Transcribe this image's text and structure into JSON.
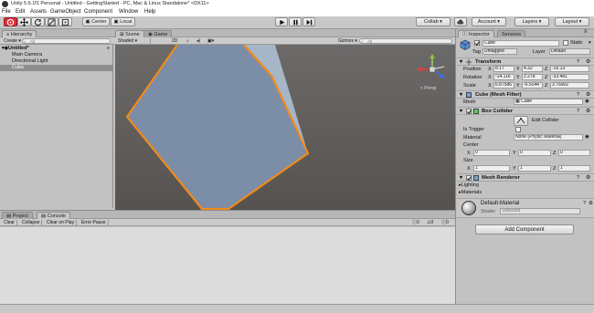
{
  "window": {
    "title": "Unity 5.6.1f1 Personal - Untitled - GettingStarted - PC, Mac & Linux Standalone* <DX11>"
  },
  "menu": [
    "File",
    "Edit",
    "Assets",
    "GameObject",
    "Component",
    "Window",
    "Help"
  ],
  "toolbar": {
    "pivot": "Center",
    "space": "Local",
    "collab": "Collab",
    "account": "Account",
    "layers": "Layers",
    "layout": "Layout"
  },
  "hierarchy": {
    "tab": "Hierarchy",
    "create": "Create",
    "search_placeholder": "All",
    "scene_name": "Untitled*",
    "items": [
      "Main Camera",
      "Directional Light",
      "Cube"
    ]
  },
  "scene": {
    "tab_scene": "Scene",
    "tab_game": "Game",
    "shading": "Shaded",
    "mode_2d": "2D",
    "gizmos": "Gizmos",
    "search_placeholder": "All",
    "persp": "< Persp"
  },
  "bottom": {
    "tab_project": "Project",
    "tab_console": "Console",
    "buttons": [
      "Clear",
      "Collapse",
      "Clear on Play",
      "Error Pause"
    ],
    "counts": [
      "0",
      "0",
      "0"
    ]
  },
  "inspector": {
    "tab": "Inspector",
    "tab_services": "Services",
    "object_name": "Cube",
    "static_label": "Static",
    "tag_label": "Tag",
    "tag_value": "Untagged",
    "layer_label": "Layer",
    "layer_value": "Default",
    "transform": {
      "title": "Transform",
      "position_label": "Position",
      "rotation_label": "Rotation",
      "scale_label": "Scale",
      "position": [
        "8.17",
        "4.32",
        "-16.13"
      ],
      "rotation": [
        "-14.116",
        "2.278",
        "-33.481"
      ],
      "scale": [
        "6.87586",
        "-6.9144",
        "3.76902"
      ],
      "x": "X",
      "y": "Y",
      "z": "Z"
    },
    "mesh_filter": {
      "title": "Cube (Mesh Filter)",
      "mesh_label": "Mesh",
      "mesh_value": "Cube"
    },
    "box_collider": {
      "title": "Box Collider",
      "edit_label": "Edit Collider",
      "is_trigger_label": "Is Trigger",
      "material_label": "Material",
      "material_value": "None (Physic Material)",
      "center_label": "Center",
      "center": [
        "0",
        "0",
        "0"
      ],
      "size_label": "Size",
      "size": [
        "1",
        "1",
        "1"
      ]
    },
    "mesh_renderer": {
      "title": "Mesh Renderer",
      "lighting": "Lighting",
      "materials": "Materials"
    },
    "material": {
      "name": "Default-Material",
      "shader_label": "Shader",
      "shader_value": "Standard"
    },
    "add_component": "Add Component"
  },
  "colors": {
    "selection_outline": "#f08a1c",
    "cube_face": "#7d8ea8",
    "active_tool": "#e0323a"
  }
}
